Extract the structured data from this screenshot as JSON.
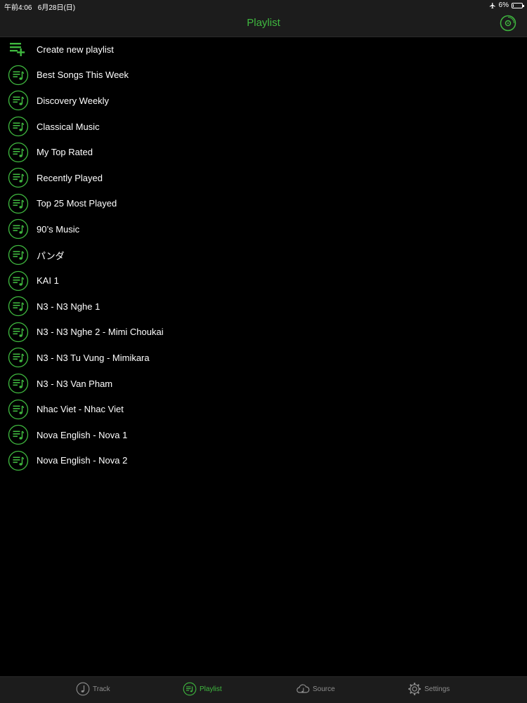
{
  "status_bar": {
    "time_date": "午前4:06   6月28日(日)",
    "airplane_icon": "airplane-icon",
    "battery_text": "6%",
    "battery_level": 0.06
  },
  "nav": {
    "title": "Playlist",
    "right_icon": "disc-icon"
  },
  "colors": {
    "accent": "#3fb83f",
    "background": "#000000",
    "bar": "#1c1c1c",
    "inactive": "#8e8e8e"
  },
  "create_row": {
    "label": "Create new playlist",
    "icon": "playlist-add-icon"
  },
  "playlists": [
    {
      "label": "Best Songs This Week"
    },
    {
      "label": "Discovery Weekly"
    },
    {
      "label": "Classical Music"
    },
    {
      "label": "My Top Rated"
    },
    {
      "label": "Recently Played"
    },
    {
      "label": "Top 25 Most Played"
    },
    {
      "label": "90’s Music"
    },
    {
      "label": "パンダ"
    },
    {
      "label": "KAI 1"
    },
    {
      "label": "N3 - N3 Nghe 1"
    },
    {
      "label": "N3 - N3 Nghe 2 - Mimi Choukai"
    },
    {
      "label": "N3 - N3 Tu Vung - Mimikara"
    },
    {
      "label": "N3 - N3 Van Pham"
    },
    {
      "label": "Nhac Viet - Nhac Viet"
    },
    {
      "label": "Nova English - Nova 1"
    },
    {
      "label": "Nova English - Nova 2"
    }
  ],
  "tabs": [
    {
      "label": "Track",
      "icon": "music-note-icon",
      "active": false
    },
    {
      "label": "Playlist",
      "icon": "playlist-icon",
      "active": true
    },
    {
      "label": "Source",
      "icon": "cloud-music-icon",
      "active": false
    },
    {
      "label": "Settings",
      "icon": "gear-icon",
      "active": false
    }
  ]
}
